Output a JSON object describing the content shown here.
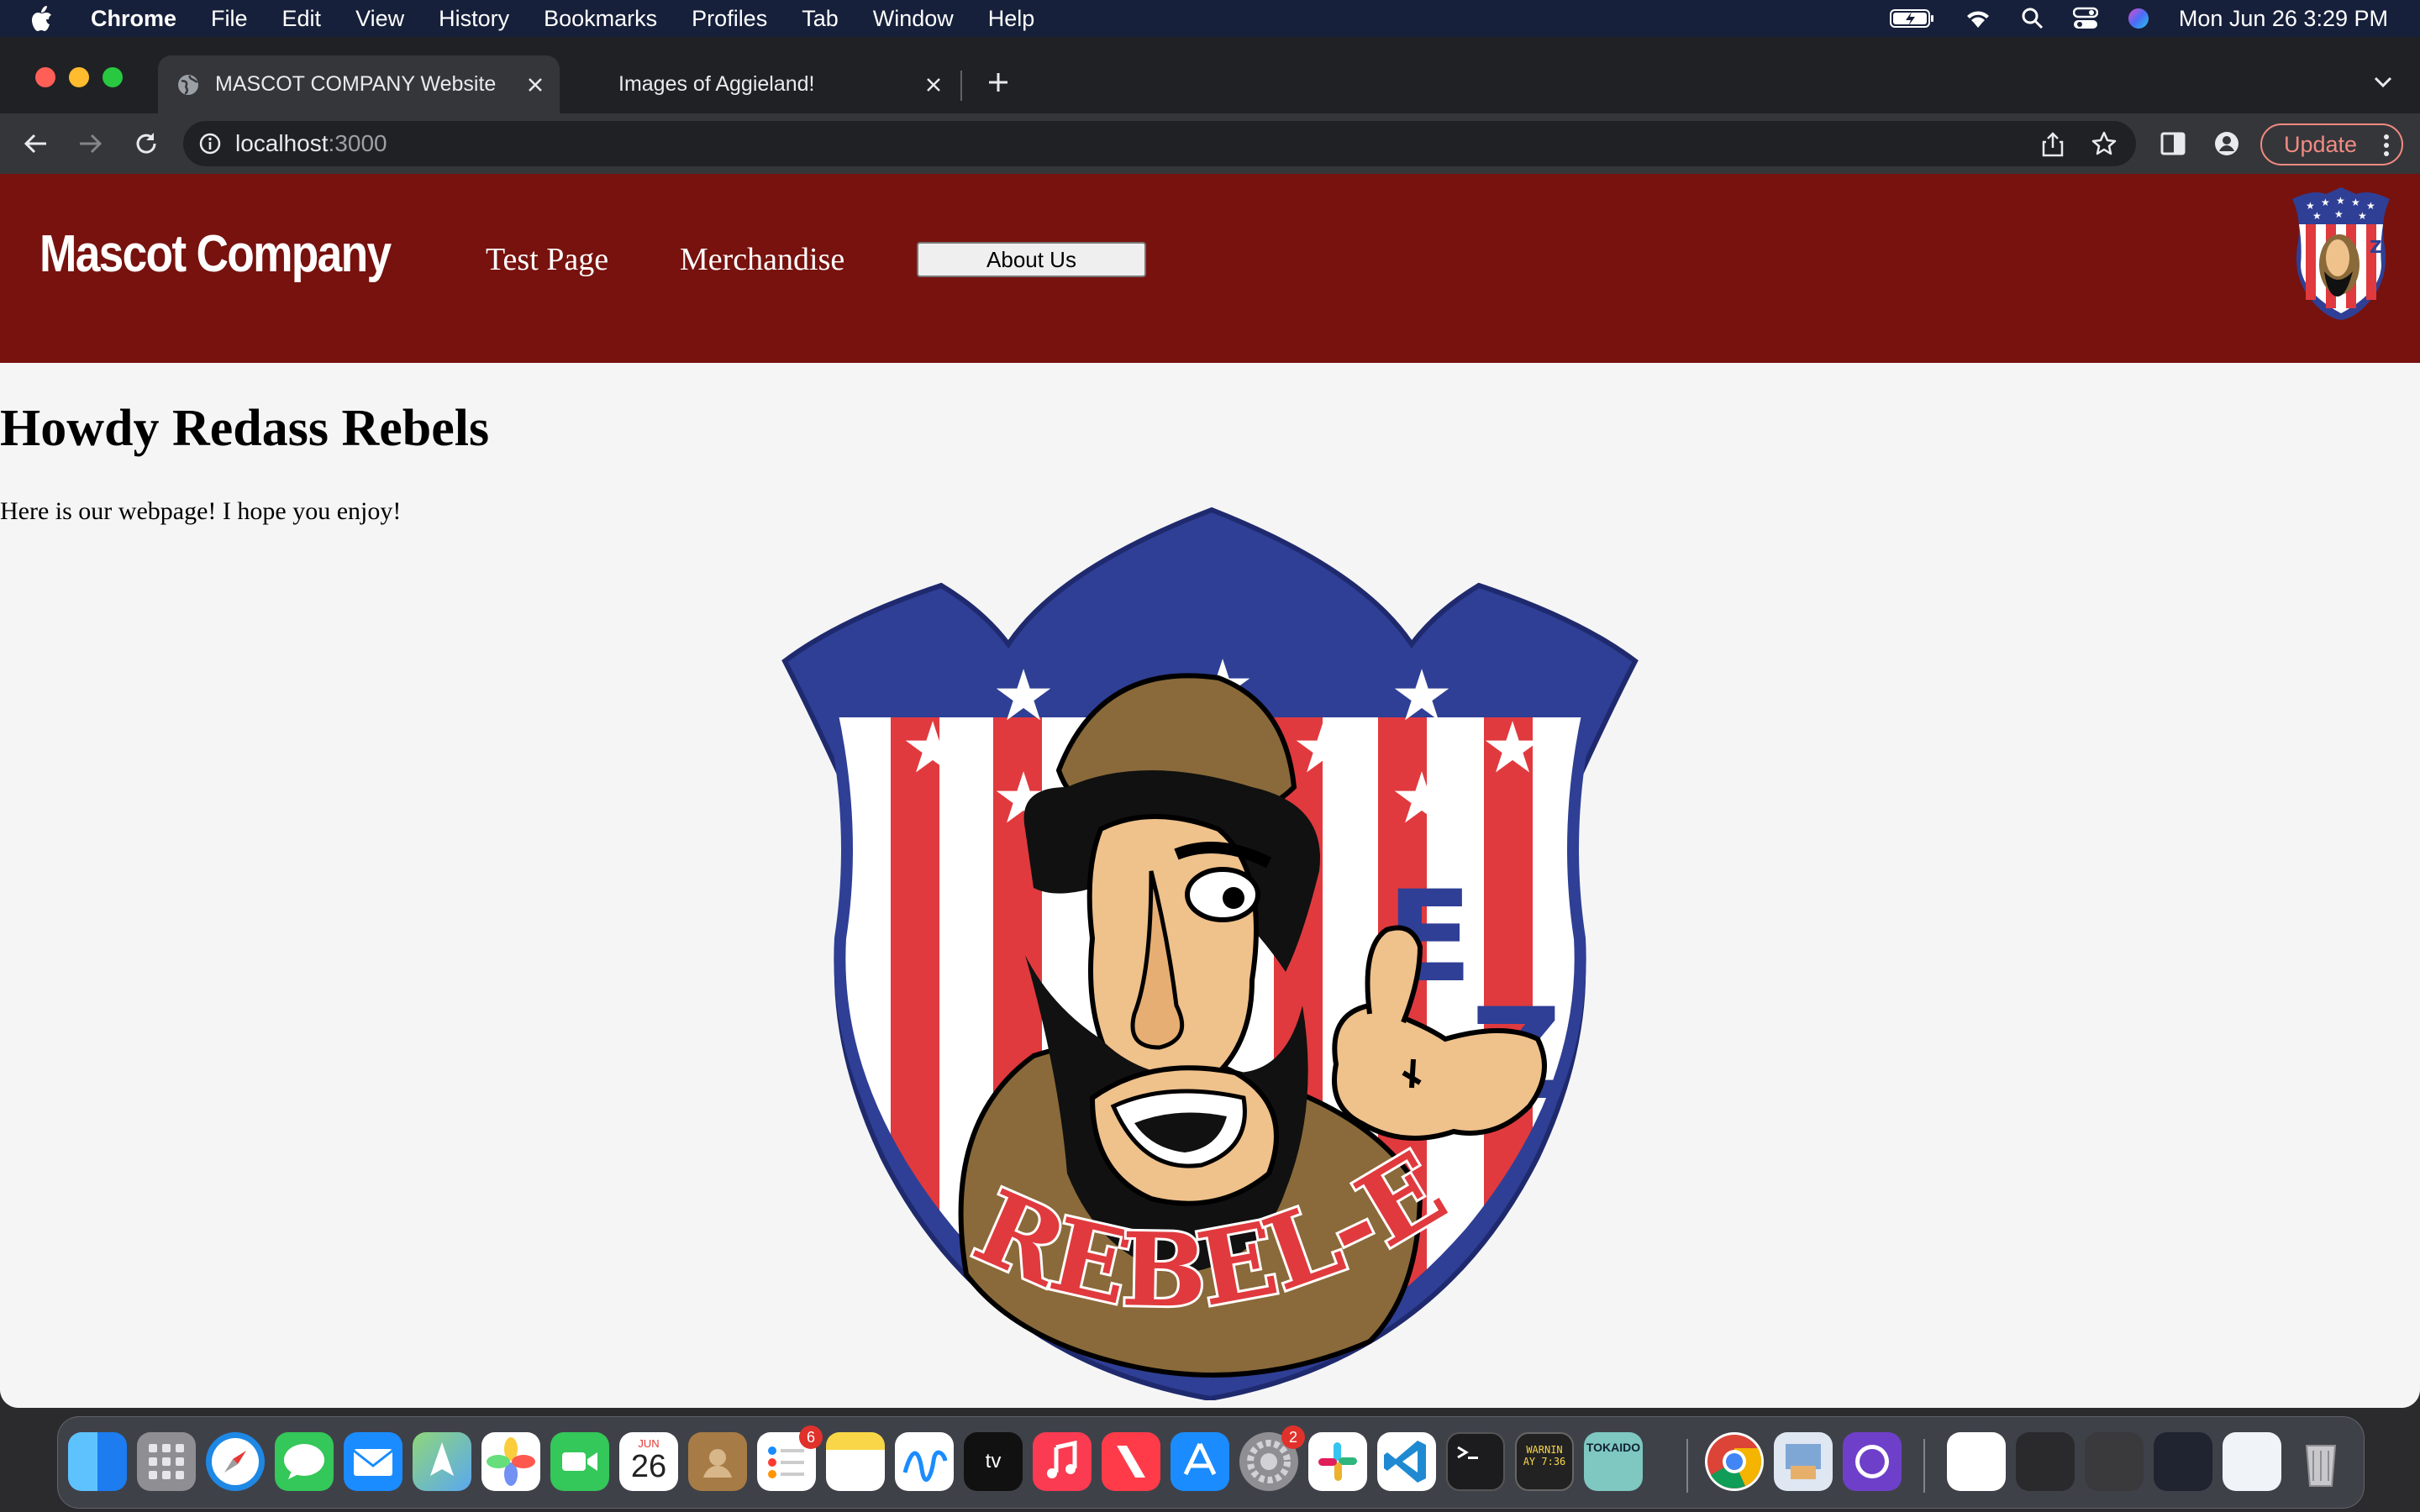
{
  "menubar": {
    "app": "Chrome",
    "items": [
      "File",
      "Edit",
      "View",
      "History",
      "Bookmarks",
      "Profiles",
      "Tab",
      "Window",
      "Help"
    ],
    "datetime": "Mon Jun 26  3:29 PM"
  },
  "browser": {
    "tabs": [
      {
        "title": "MASCOT COMPANY Website",
        "active": true
      },
      {
        "title": "Images of Aggieland!",
        "active": false
      }
    ],
    "url_host": "localhost",
    "url_port": ":3000",
    "update_label": "Update"
  },
  "site": {
    "brand": "Mascot Company",
    "nav": {
      "test": "Test Page",
      "merch": "Merchandise",
      "about": "About Us"
    },
    "heading": "Howdy Redass Rebels",
    "intro": "Here is our webpage! I hope you enjoy!",
    "logo_text": "REBEL-E",
    "logo_letters": "EZ",
    "colors": {
      "header": "#77120e",
      "shield_blue": "#2f3f95",
      "stripe_red": "#e03a3e"
    }
  },
  "dock": {
    "calendar_month": "JUN",
    "calendar_day": "26",
    "reminders_badge": "6",
    "settings_badge": "2",
    "console_label": "WARNIN",
    "console_time": "AY 7:36",
    "tokaido_label": "TOKAIDO",
    "tv_label": "tv"
  }
}
